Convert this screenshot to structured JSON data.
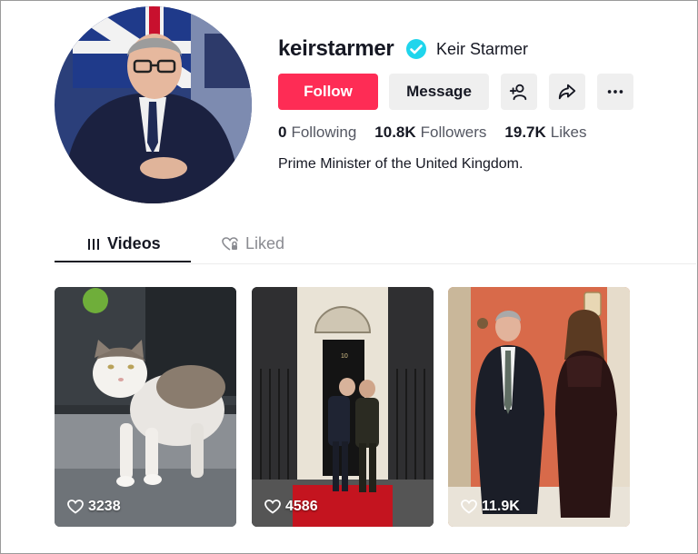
{
  "profile": {
    "username": "keirstarmer",
    "display_name": "Keir Starmer",
    "verified": true,
    "bio": "Prime Minister of the United Kingdom."
  },
  "actions": {
    "follow_label": "Follow",
    "message_label": "Message",
    "add_friend_icon": "add-user-icon",
    "share_icon": "share-icon",
    "more_icon": "more-icon"
  },
  "stats": {
    "following": {
      "value": "0",
      "label": "Following"
    },
    "followers": {
      "value": "10.8K",
      "label": "Followers"
    },
    "likes": {
      "value": "19.7K",
      "label": "Likes"
    }
  },
  "tabs": [
    {
      "label": "Videos",
      "icon": "grid-icon",
      "active": true
    },
    {
      "label": "Liked",
      "icon": "heart-lock-icon",
      "active": false
    }
  ],
  "videos": [
    {
      "views": "3238"
    },
    {
      "views": "4586"
    },
    {
      "views": "11.9K"
    }
  ],
  "colors": {
    "accent": "#fe2c55",
    "verified": "#20d5ec",
    "button_bg": "#efefef",
    "text_secondary": "#545762"
  }
}
